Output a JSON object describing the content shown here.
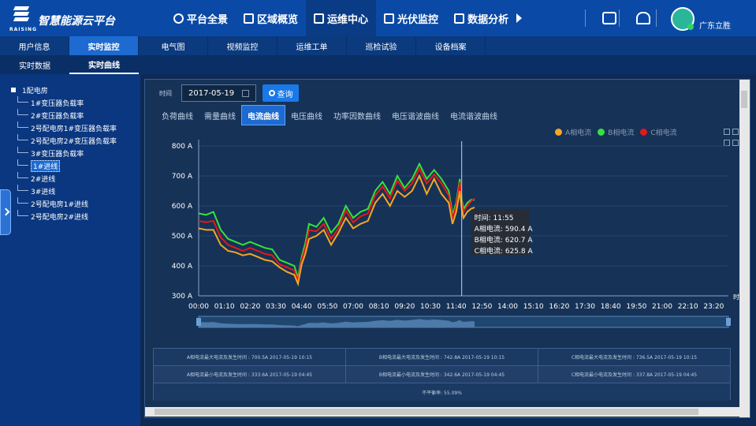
{
  "app": {
    "brand_small": "RAISING",
    "brand_sub": "立胜智慧",
    "title": "智慧能源云平台"
  },
  "nav": {
    "items": [
      {
        "label": "平台全景",
        "icon": "globe-icon"
      },
      {
        "label": "区域概览",
        "icon": "chart-icon"
      },
      {
        "label": "运维中心",
        "icon": "edit-icon"
      },
      {
        "label": "光伏监控",
        "icon": "camera-icon"
      },
      {
        "label": "数据分析",
        "icon": "bar-chart-icon"
      }
    ],
    "active_index": 2,
    "user": "广东立胜"
  },
  "subnav": {
    "items": [
      "用户信息",
      "实时监控",
      "电气图",
      "视频监控",
      "运维工单",
      "巡检试验",
      "设备档案"
    ],
    "active_index": 1
  },
  "subnav2": {
    "items": [
      "实时数据",
      "实时曲线"
    ],
    "active_index": 1
  },
  "tree": {
    "root": "1配电房",
    "items": [
      "1#变压器负载率",
      "2#变压器负载率",
      "2号配电房1#变压器负载率",
      "2号配电房2#变压器负载率",
      "3#变压器负载率",
      "1#进线",
      "2#进线",
      "3#进线",
      "2号配电房1#进线",
      "2号配电房2#进线"
    ],
    "selected_index": 5
  },
  "query": {
    "label": "时间",
    "date": "2017-05-19",
    "button": "查询"
  },
  "tabs": {
    "items": [
      "负荷曲线",
      "需量曲线",
      "电流曲线",
      "电压曲线",
      "功率因数曲线",
      "电压谐波曲线",
      "电流谐波曲线"
    ],
    "active_index": 2
  },
  "legend": [
    {
      "name": "A相电流",
      "color": "#f5a623"
    },
    {
      "name": "B相电流",
      "color": "#35e23c"
    },
    {
      "name": "C相电流",
      "color": "#e8161a"
    }
  ],
  "tooltip": {
    "time": "时间: 11:55",
    "a": "A相电流: 590.4 A",
    "b": "B相电流: 620.7 A",
    "c": "C相电流: 625.8 A"
  },
  "chart_data": {
    "type": "line",
    "ylim": [
      300,
      800
    ],
    "yticks": [
      "300 A",
      "400 A",
      "500 A",
      "600 A",
      "700 A",
      "800 A"
    ],
    "xticks": [
      "00:00",
      "01:10",
      "02:20",
      "03:30",
      "04:40",
      "05:50",
      "07:00",
      "08:10",
      "09:20",
      "10:30",
      "11:40",
      "12:50",
      "14:00",
      "15:10",
      "16:20",
      "17:30",
      "18:40",
      "19:50",
      "21:00",
      "22:10",
      "23:20"
    ],
    "x_axis_label": "时",
    "x_minutes": [
      0,
      20,
      40,
      60,
      80,
      100,
      120,
      140,
      160,
      180,
      200,
      220,
      240,
      260,
      270,
      280,
      290,
      300,
      320,
      340,
      360,
      380,
      400,
      420,
      440,
      460,
      480,
      500,
      520,
      540,
      560,
      580,
      600,
      620,
      640,
      660,
      680,
      690,
      700,
      710,
      715,
      720,
      730,
      740,
      750
    ],
    "series": [
      {
        "name": "A相电流",
        "color": "#f5a623",
        "values": [
          525,
          520,
          520,
          470,
          450,
          445,
          435,
          440,
          430,
          420,
          415,
          395,
          380,
          370,
          340,
          405,
          440,
          490,
          500,
          520,
          470,
          510,
          560,
          525,
          540,
          550,
          610,
          640,
          600,
          650,
          630,
          650,
          700,
          640,
          690,
          640,
          610,
          540,
          580,
          650,
          590,
          560,
          580,
          590,
          595
        ]
      },
      {
        "name": "B相电流",
        "color": "#35e23c",
        "values": [
          575,
          570,
          580,
          520,
          490,
          480,
          470,
          480,
          470,
          460,
          455,
          420,
          410,
          400,
          360,
          430,
          475,
          540,
          530,
          560,
          510,
          540,
          600,
          560,
          580,
          590,
          650,
          680,
          640,
          700,
          660,
          690,
          740,
          690,
          720,
          690,
          650,
          570,
          610,
          690,
          620,
          590,
          610,
          620,
          620
        ]
      },
      {
        "name": "C相电流",
        "color": "#e8161a",
        "values": [
          550,
          545,
          550,
          495,
          470,
          460,
          450,
          460,
          450,
          440,
          435,
          405,
          395,
          385,
          350,
          420,
          460,
          520,
          515,
          540,
          490,
          525,
          585,
          545,
          565,
          575,
          635,
          665,
          625,
          685,
          650,
          675,
          725,
          675,
          705,
          675,
          635,
          560,
          600,
          680,
          610,
          580,
          600,
          615,
          625
        ]
      }
    ]
  },
  "stats": {
    "r1": [
      "A相电流最大电流及发生时间 : 700.5A 2017-05-19 10:15",
      "B相电流最大电流及发生时间 : 742.8A 2017-05-19 10:15",
      "C相电流最大电流及发生时间 : 736.5A 2017-05-19 10:15"
    ],
    "r2": [
      "A相电流最小电流及发生时间 : 333.6A 2017-05-19 04:45",
      "B相电流最小电流及发生时间 : 342.6A 2017-05-19 04:45",
      "C相电流最小电流及发生时间 : 337.8A 2017-05-19 04:45"
    ],
    "r3": "不平衡率: 55.09%"
  }
}
